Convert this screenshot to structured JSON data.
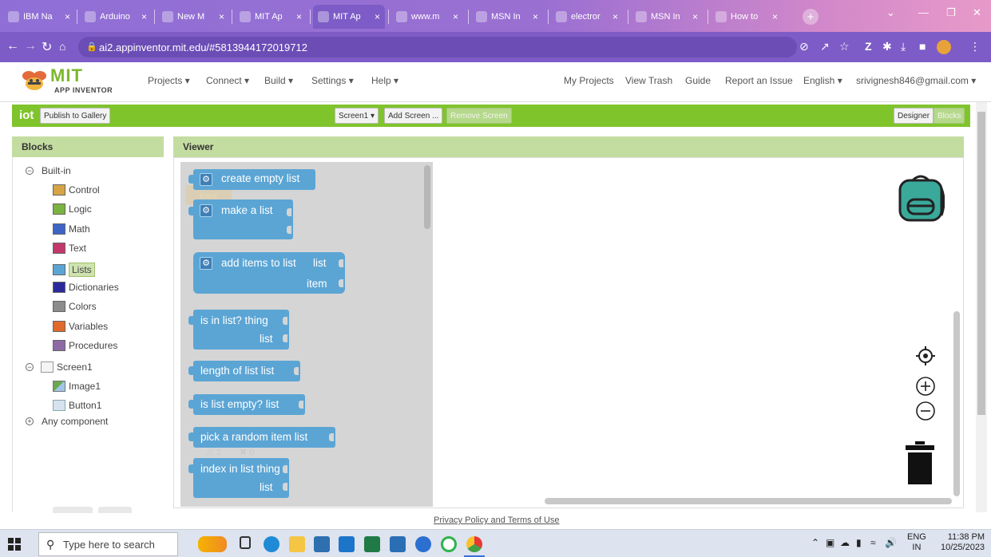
{
  "browser": {
    "tabs": [
      {
        "title": "IBM Na",
        "icon": "ibm-icon",
        "color": "#8e6ad0"
      },
      {
        "title": "Arduino",
        "icon": "wikipedia-icon",
        "color": "#8e6ad0"
      },
      {
        "title": "New M",
        "icon": "wikipedia-icon",
        "color": "#8e6ad0"
      },
      {
        "title": "MIT Ap",
        "icon": "mit-app-inventor-icon",
        "color": "#8e6ad0"
      },
      {
        "title": "MIT Ap",
        "icon": "mit-app-inventor-icon",
        "color": "#7d5cc7",
        "active": true
      },
      {
        "title": "www.m",
        "icon": "globe-icon",
        "color": "#8e6ad0"
      },
      {
        "title": "MSN In",
        "icon": "msn-icon",
        "color": "#8e6ad0"
      },
      {
        "title": "electror",
        "icon": "page-icon",
        "color": "#8e6ad0"
      },
      {
        "title": "MSN In",
        "icon": "msn-icon",
        "color": "#8e6ad0"
      },
      {
        "title": "How to",
        "icon": "globe-icon",
        "color": "#8e6ad0"
      }
    ],
    "url": "ai2.appinventor.mit.edu/#5813944172019712"
  },
  "app_header": {
    "logo_title": "MIT",
    "logo_subtitle": "APP INVENTOR",
    "menus": [
      "Projects ▾",
      "Connect ▾",
      "Build ▾",
      "Settings ▾",
      "Help ▾"
    ],
    "right_links": [
      "My Projects",
      "View Trash",
      "Guide",
      "Report an Issue",
      "English ▾",
      "srivignesh846@gmail.com ▾"
    ]
  },
  "project_bar": {
    "project_name": "iot",
    "publish_label": "Publish to Gallery",
    "screen_label": "Screen1 ▾",
    "add_screen_label": "Add Screen ...",
    "remove_screen_label": "Remove Screen",
    "designer_label": "Designer",
    "blocks_label": "Blocks"
  },
  "blocks_panel": {
    "title": "Blocks",
    "builtin_label": "Built-in",
    "builtin_items": [
      {
        "label": "Control",
        "color": "#d7a445"
      },
      {
        "label": "Logic",
        "color": "#7bb342"
      },
      {
        "label": "Math",
        "color": "#3f64c7"
      },
      {
        "label": "Text",
        "color": "#c2386a"
      },
      {
        "label": "Lists",
        "color": "#5ba5d5",
        "selected": true
      },
      {
        "label": "Dictionaries",
        "color": "#2a2a9c"
      },
      {
        "label": "Colors",
        "color": "#8c8c8c"
      },
      {
        "label": "Variables",
        "color": "#e2692c"
      },
      {
        "label": "Procedures",
        "color": "#8e6aa5"
      }
    ],
    "screen_label": "Screen1",
    "screen_children": [
      "Image1",
      "Button1"
    ],
    "any_component_label": "Any component"
  },
  "viewer": {
    "title": "Viewer",
    "blocks": {
      "create_empty_list": "create empty list",
      "make_a_list": "make a list",
      "add_items_to_list": "add items to list",
      "add_items_list_arg": "list",
      "add_items_item_arg": "item",
      "is_in_list": "is in list? thing",
      "is_in_list_arg": "list",
      "length_of_list": "length of list  list",
      "is_list_empty": "is list empty?  list",
      "pick_random_item": "pick a random item  list",
      "index_in_list": "index in list  thing",
      "index_in_list_arg": "list"
    },
    "ghost_then": "then",
    "warning_count": "2",
    "error_count": "0"
  },
  "footer": {
    "privacy": "Privacy Policy and Terms of Use"
  },
  "taskbar": {
    "search_placeholder": "Type here to search",
    "lang": "ENG",
    "region": "IN",
    "time": "11:38 PM",
    "date": "10/25/2023"
  }
}
